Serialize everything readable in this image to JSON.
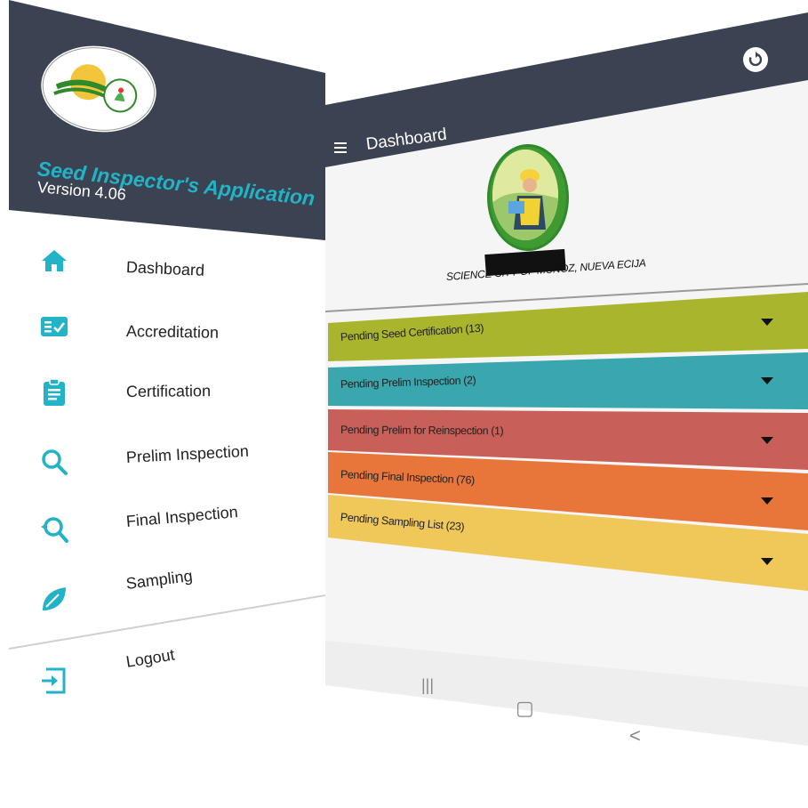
{
  "drawer": {
    "app_title": "Seed Inspector's Application",
    "version": "Version 4.06",
    "items": [
      {
        "label": "Dashboard",
        "icon": "home-icon"
      },
      {
        "label": "Accreditation",
        "icon": "id-card-icon"
      },
      {
        "label": "Certification",
        "icon": "clipboard-icon"
      },
      {
        "label": "Prelim Inspection",
        "icon": "search-icon"
      },
      {
        "label": "Final Inspection",
        "icon": "search-refresh-icon"
      },
      {
        "label": "Sampling",
        "icon": "leaf-icon"
      }
    ],
    "logout_label": "Logout",
    "logout_icon": "logout-icon"
  },
  "dashboard": {
    "title": "Dashboard",
    "menu_icon": "hamburger-icon",
    "refresh_icon": "refresh-icon",
    "location": "SCIENCE CITY OF MUÑOZ, NUEVA ECIJA",
    "strips": [
      {
        "label": "Pending Seed Certification (13)",
        "color": "#a9b52c"
      },
      {
        "label": "Pending Prelim Inspection (2)",
        "color": "#3aa6ae"
      },
      {
        "label": "Pending Prelim for Reinspection (1)",
        "color": "#c85f58"
      },
      {
        "label": "Pending Final Inspection (76)",
        "color": "#e8763a"
      },
      {
        "label": "Pending Sampling List (23)",
        "color": "#f0c85a"
      }
    ]
  },
  "navbar": {
    "recents_glyph": "|||",
    "home_glyph": "▢",
    "back_glyph": "<"
  },
  "colors": {
    "header": "#3b4252",
    "accent": "#22b3c7"
  }
}
